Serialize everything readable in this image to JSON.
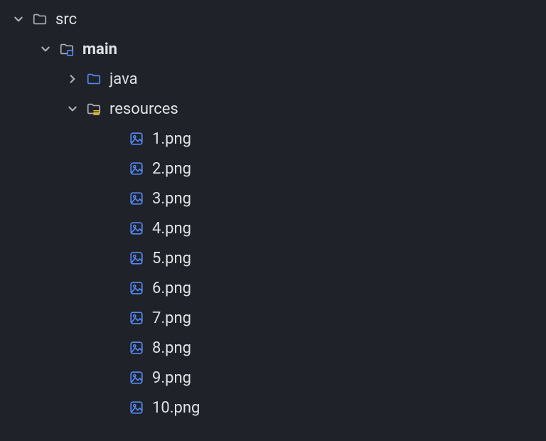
{
  "colors": {
    "bg": "#1f2228",
    "text": "#dfe1e5",
    "muted_icon": "#b0b3b8",
    "accent_blue": "#548AF7",
    "overlay_yellow": "#f1c40f"
  },
  "src": {
    "label": "src",
    "expanded": true,
    "main": {
      "label": "main",
      "expanded": true,
      "java": {
        "label": "java",
        "expanded": false
      },
      "resources": {
        "label": "resources",
        "expanded": true,
        "files": [
          {
            "name": "1.png"
          },
          {
            "name": "2.png"
          },
          {
            "name": "3.png"
          },
          {
            "name": "4.png"
          },
          {
            "name": "5.png"
          },
          {
            "name": "6.png"
          },
          {
            "name": "7.png"
          },
          {
            "name": "8.png"
          },
          {
            "name": "9.png"
          },
          {
            "name": "10.png"
          }
        ]
      }
    }
  }
}
